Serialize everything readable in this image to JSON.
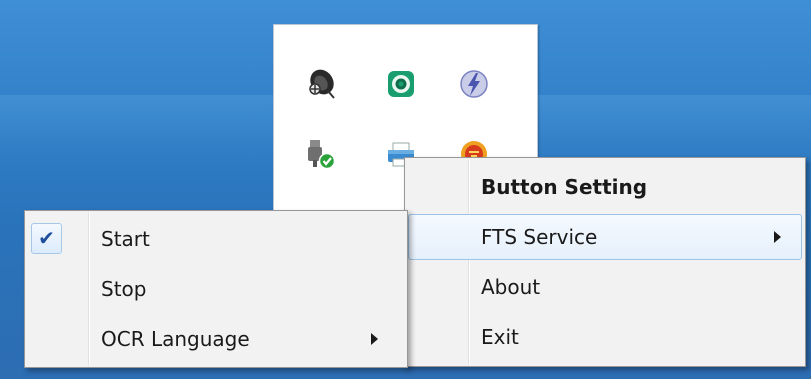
{
  "screen": {
    "width": 811,
    "height": 379,
    "background": "#2f7dc6"
  },
  "tray": {
    "icons": [
      {
        "name": "satellite-dish-icon"
      },
      {
        "name": "green-circle-icon"
      },
      {
        "name": "lightning-icon"
      },
      {
        "name": "usb-safely-remove-icon"
      },
      {
        "name": "printer-icon"
      },
      {
        "name": "red-shield-icon"
      }
    ]
  },
  "context_menu": {
    "items": [
      {
        "label": "Button Setting",
        "bold": true
      },
      {
        "label": "FTS Service",
        "has_submenu": true,
        "highlighted": true
      },
      {
        "label": "About"
      },
      {
        "label": "Exit"
      }
    ]
  },
  "submenu": {
    "items": [
      {
        "label": "Start",
        "checked": true,
        "check_glyph": "✔"
      },
      {
        "label": "Stop"
      },
      {
        "label": "OCR Language",
        "has_submenu": true
      }
    ]
  },
  "colors": {
    "highlight_border": "#9cc4e8",
    "menu_bg": "#f2f2f2",
    "check": "#1f4f9a"
  }
}
